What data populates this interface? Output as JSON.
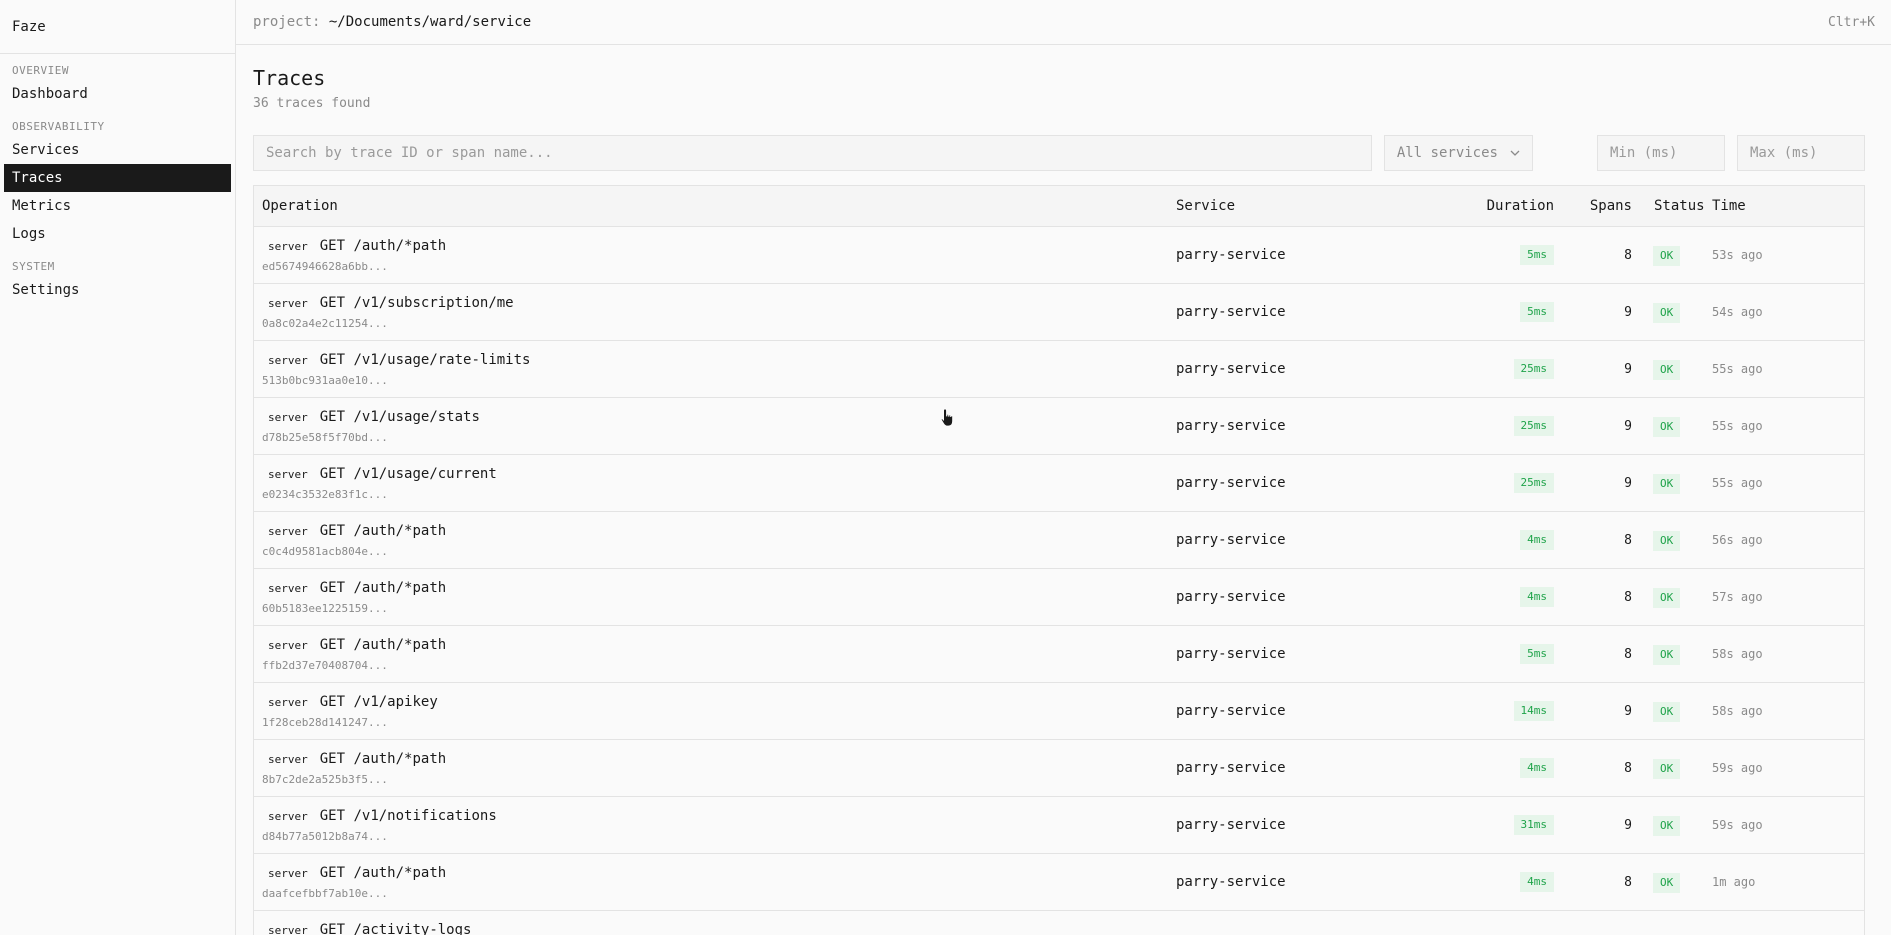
{
  "sidebar": {
    "brand": "Faze",
    "sections": [
      {
        "title": "OVERVIEW",
        "items": [
          {
            "label": "Dashboard"
          }
        ]
      },
      {
        "title": "OBSERVABILITY",
        "items": [
          {
            "label": "Services"
          },
          {
            "label": "Traces"
          },
          {
            "label": "Metrics"
          },
          {
            "label": "Logs"
          }
        ]
      },
      {
        "title": "SYSTEM",
        "items": [
          {
            "label": "Settings"
          }
        ]
      }
    ],
    "active": "Traces"
  },
  "topbar": {
    "project_label": "project:",
    "project_path": "~/Documents/ward/service",
    "shortcut": "Cltr+K"
  },
  "page": {
    "title": "Traces",
    "subtitle": "36 traces found"
  },
  "filters": {
    "search_placeholder": "Search by trace ID or span name...",
    "service_select": "All services",
    "min_placeholder": "Min (ms)",
    "max_placeholder": "Max (ms)"
  },
  "table": {
    "headers": {
      "operation": "Operation",
      "service": "Service",
      "duration": "Duration",
      "spans": "Spans",
      "status": "Status",
      "time": "Time"
    },
    "rows": [
      {
        "kind": "server",
        "op": "GET /auth/*path",
        "id": "ed5674946628a6bb...",
        "service": "parry-service",
        "duration": "5ms",
        "spans": "8",
        "status": "OK",
        "time": "53s ago"
      },
      {
        "kind": "server",
        "op": "GET /v1/subscription/me",
        "id": "0a8c02a4e2c11254...",
        "service": "parry-service",
        "duration": "5ms",
        "spans": "9",
        "status": "OK",
        "time": "54s ago"
      },
      {
        "kind": "server",
        "op": "GET /v1/usage/rate-limits",
        "id": "513b0bc931aa0e10...",
        "service": "parry-service",
        "duration": "25ms",
        "spans": "9",
        "status": "OK",
        "time": "55s ago"
      },
      {
        "kind": "server",
        "op": "GET /v1/usage/stats",
        "id": "d78b25e58f5f70bd...",
        "service": "parry-service",
        "duration": "25ms",
        "spans": "9",
        "status": "OK",
        "time": "55s ago"
      },
      {
        "kind": "server",
        "op": "GET /v1/usage/current",
        "id": "e0234c3532e83f1c...",
        "service": "parry-service",
        "duration": "25ms",
        "spans": "9",
        "status": "OK",
        "time": "55s ago"
      },
      {
        "kind": "server",
        "op": "GET /auth/*path",
        "id": "c0c4d9581acb804e...",
        "service": "parry-service",
        "duration": "4ms",
        "spans": "8",
        "status": "OK",
        "time": "56s ago"
      },
      {
        "kind": "server",
        "op": "GET /auth/*path",
        "id": "60b5183ee1225159...",
        "service": "parry-service",
        "duration": "4ms",
        "spans": "8",
        "status": "OK",
        "time": "57s ago"
      },
      {
        "kind": "server",
        "op": "GET /auth/*path",
        "id": "ffb2d37e70408704...",
        "service": "parry-service",
        "duration": "5ms",
        "spans": "8",
        "status": "OK",
        "time": "58s ago"
      },
      {
        "kind": "server",
        "op": "GET /v1/apikey",
        "id": "1f28ceb28d141247...",
        "service": "parry-service",
        "duration": "14ms",
        "spans": "9",
        "status": "OK",
        "time": "58s ago"
      },
      {
        "kind": "server",
        "op": "GET /auth/*path",
        "id": "8b7c2de2a525b3f5...",
        "service": "parry-service",
        "duration": "4ms",
        "spans": "8",
        "status": "OK",
        "time": "59s ago"
      },
      {
        "kind": "server",
        "op": "GET /v1/notifications",
        "id": "d84b77a5012b8a74...",
        "service": "parry-service",
        "duration": "31ms",
        "spans": "9",
        "status": "OK",
        "time": "59s ago"
      },
      {
        "kind": "server",
        "op": "GET /auth/*path",
        "id": "daafcefbbf7ab10e...",
        "service": "parry-service",
        "duration": "4ms",
        "spans": "8",
        "status": "OK",
        "time": "1m ago"
      },
      {
        "kind": "server",
        "op": "GET /activity-logs",
        "id": "",
        "service": "",
        "duration": "",
        "spans": "",
        "status": "",
        "time": ""
      }
    ]
  },
  "colors": {
    "accent_active": "#1a1a1a",
    "ok_bg": "#e6f5ea",
    "ok_fg": "#1fa34a"
  }
}
